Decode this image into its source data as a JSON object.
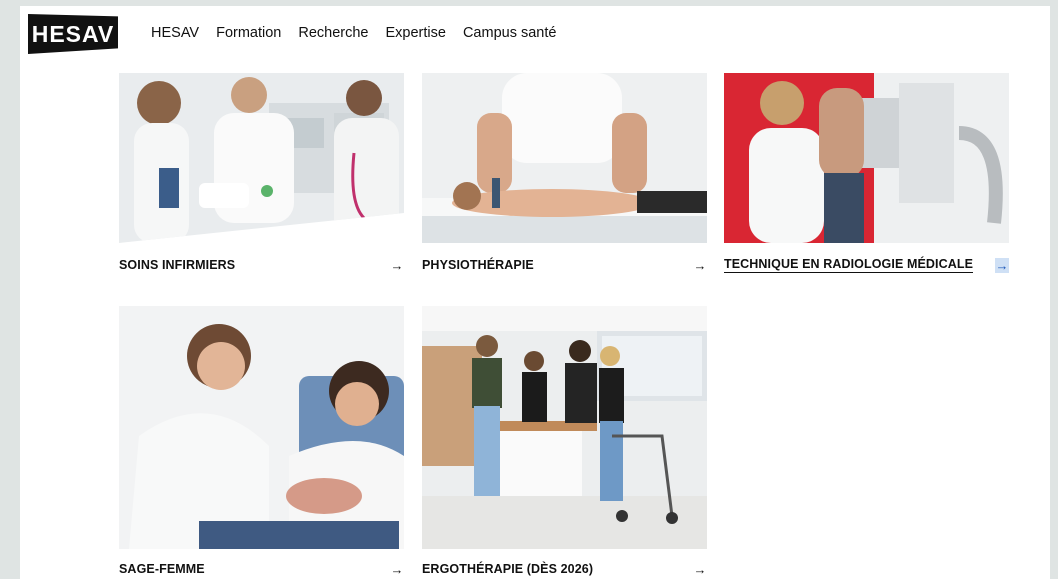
{
  "brand": {
    "logo_text": "HESAV"
  },
  "nav": {
    "items": [
      {
        "label": "HESAV"
      },
      {
        "label": "Formation"
      },
      {
        "label": "Recherche"
      },
      {
        "label": "Expertise"
      },
      {
        "label": "Campus santé"
      }
    ]
  },
  "cards": [
    {
      "label": "SOINS INFIRMIERS",
      "arrow": "→"
    },
    {
      "label": "PHYSIOTHÉRAPIE",
      "arrow": "→"
    },
    {
      "label": "TECHNIQUE EN RADIOLOGIE MÉDICALE",
      "arrow": "→"
    },
    {
      "label": "SAGE-FEMME",
      "arrow": "→"
    },
    {
      "label": "ERGOTHÉRAPIE (DÈS 2026)",
      "arrow": "→"
    }
  ],
  "colors": {
    "page_bg": "#dfe4e3",
    "card_bg": "#ffffff",
    "text": "#111111",
    "active_arrow_bg": "#cfe0f5"
  }
}
